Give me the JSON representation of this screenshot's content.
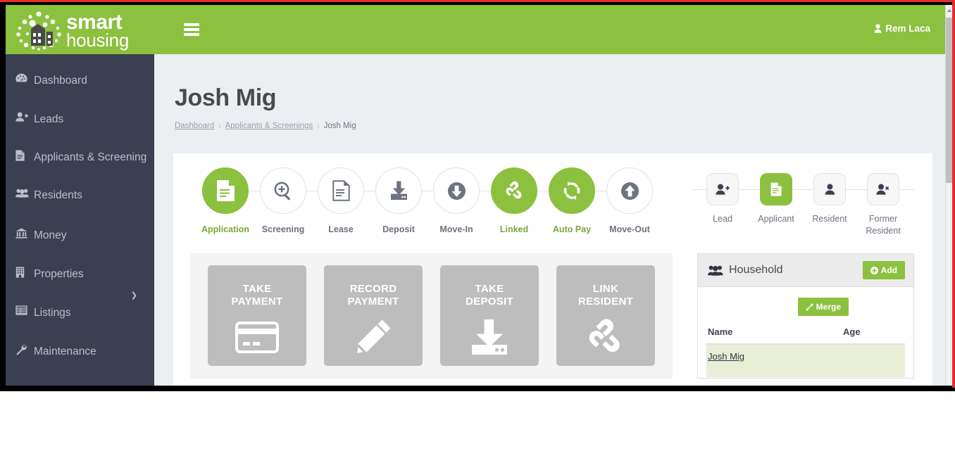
{
  "brand": {
    "line1": "smart",
    "line2": "housing",
    "logo_icon": "smart-housing-building-dots-logo"
  },
  "topbar": {
    "menu_icon": "hamburger-menu-icon",
    "user_icon": "user-icon",
    "user_name": "Rem Laca"
  },
  "sidebar": {
    "items": [
      {
        "label": "Dashboard",
        "icon": "dashboard-gauge-icon",
        "glyph": "☉",
        "caret": ""
      },
      {
        "label": "Leads",
        "icon": "user-plus-icon",
        "glyph": "☺",
        "caret": ""
      },
      {
        "label": "Applicants & Screening",
        "icon": "document-icon",
        "glyph": "☰",
        "caret": ""
      },
      {
        "label": "Residents",
        "icon": "users-group-icon",
        "glyph": "♣",
        "caret": ""
      },
      {
        "label": "Money",
        "icon": "bank-icon",
        "glyph": "⌂",
        "caret": ""
      },
      {
        "label": "Properties",
        "icon": "building-icon",
        "glyph": "▤",
        "caret": ""
      },
      {
        "label": "Listings",
        "icon": "list-window-icon",
        "glyph": "▦",
        "caret": "❯"
      },
      {
        "label": "Maintenance",
        "icon": "wrench-icon",
        "glyph": "⚒",
        "caret": ""
      }
    ]
  },
  "page": {
    "title": "Josh Mig",
    "breadcrumb": [
      {
        "label": "Dashboard",
        "link": true
      },
      {
        "label": "Applicants & Screenings",
        "link": true
      },
      {
        "label": "Josh Mig",
        "link": false
      }
    ],
    "breadcrumb_separator": "›"
  },
  "stepper": {
    "steps": [
      {
        "label": "Application",
        "icon": "document-icon",
        "state": "done"
      },
      {
        "label": "Screening",
        "icon": "magnifier-plus-icon",
        "state": "todo"
      },
      {
        "label": "Lease",
        "icon": "document-lines-icon",
        "state": "todo"
      },
      {
        "label": "Deposit",
        "icon": "download-tray-icon",
        "state": "todo"
      },
      {
        "label": "Move-In",
        "icon": "arrow-down-circle-icon",
        "state": "todo"
      },
      {
        "label": "Linked",
        "icon": "chain-link-icon",
        "state": "done"
      },
      {
        "label": "Auto Pay",
        "icon": "refresh-sync-icon",
        "state": "done"
      },
      {
        "label": "Move-Out",
        "icon": "arrow-up-circle-icon",
        "state": "todo"
      }
    ]
  },
  "roles": {
    "items": [
      {
        "label": "Lead",
        "icon": "user-plus-icon",
        "state": "inactive"
      },
      {
        "label": "Applicant",
        "icon": "document-icon",
        "state": "active"
      },
      {
        "label": "Resident",
        "icon": "user-icon",
        "state": "inactive"
      },
      {
        "label": "Former Resident",
        "icon": "user-remove-icon",
        "state": "inactive"
      }
    ]
  },
  "actions": {
    "tiles": [
      {
        "line1": "TAKE",
        "line2": "PAYMENT",
        "icon": "credit-card-icon"
      },
      {
        "line1": "RECORD",
        "line2": "PAYMENT",
        "icon": "pencil-icon"
      },
      {
        "line1": "TAKE",
        "line2": "DEPOSIT",
        "icon": "download-tray-icon"
      },
      {
        "line1": "LINK",
        "line2": "RESIDENT",
        "icon": "chain-link-icon"
      }
    ]
  },
  "household": {
    "title": "Household",
    "title_icon": "users-group-icon",
    "add_label": "Add",
    "add_icon": "plus-circle-icon",
    "merge_label": "Merge",
    "merge_icon": "merge-arrows-icon",
    "columns": [
      "Name",
      "Age"
    ],
    "rows": [
      {
        "name": "Josh Mig",
        "age": ""
      }
    ]
  },
  "colors": {
    "brand_green": "#8cc03f",
    "sidebar_dark": "#3a4050",
    "page_bg": "#eceff1",
    "tile_gray": "#bdbdbd",
    "row_highlight": "#e8efd6"
  }
}
